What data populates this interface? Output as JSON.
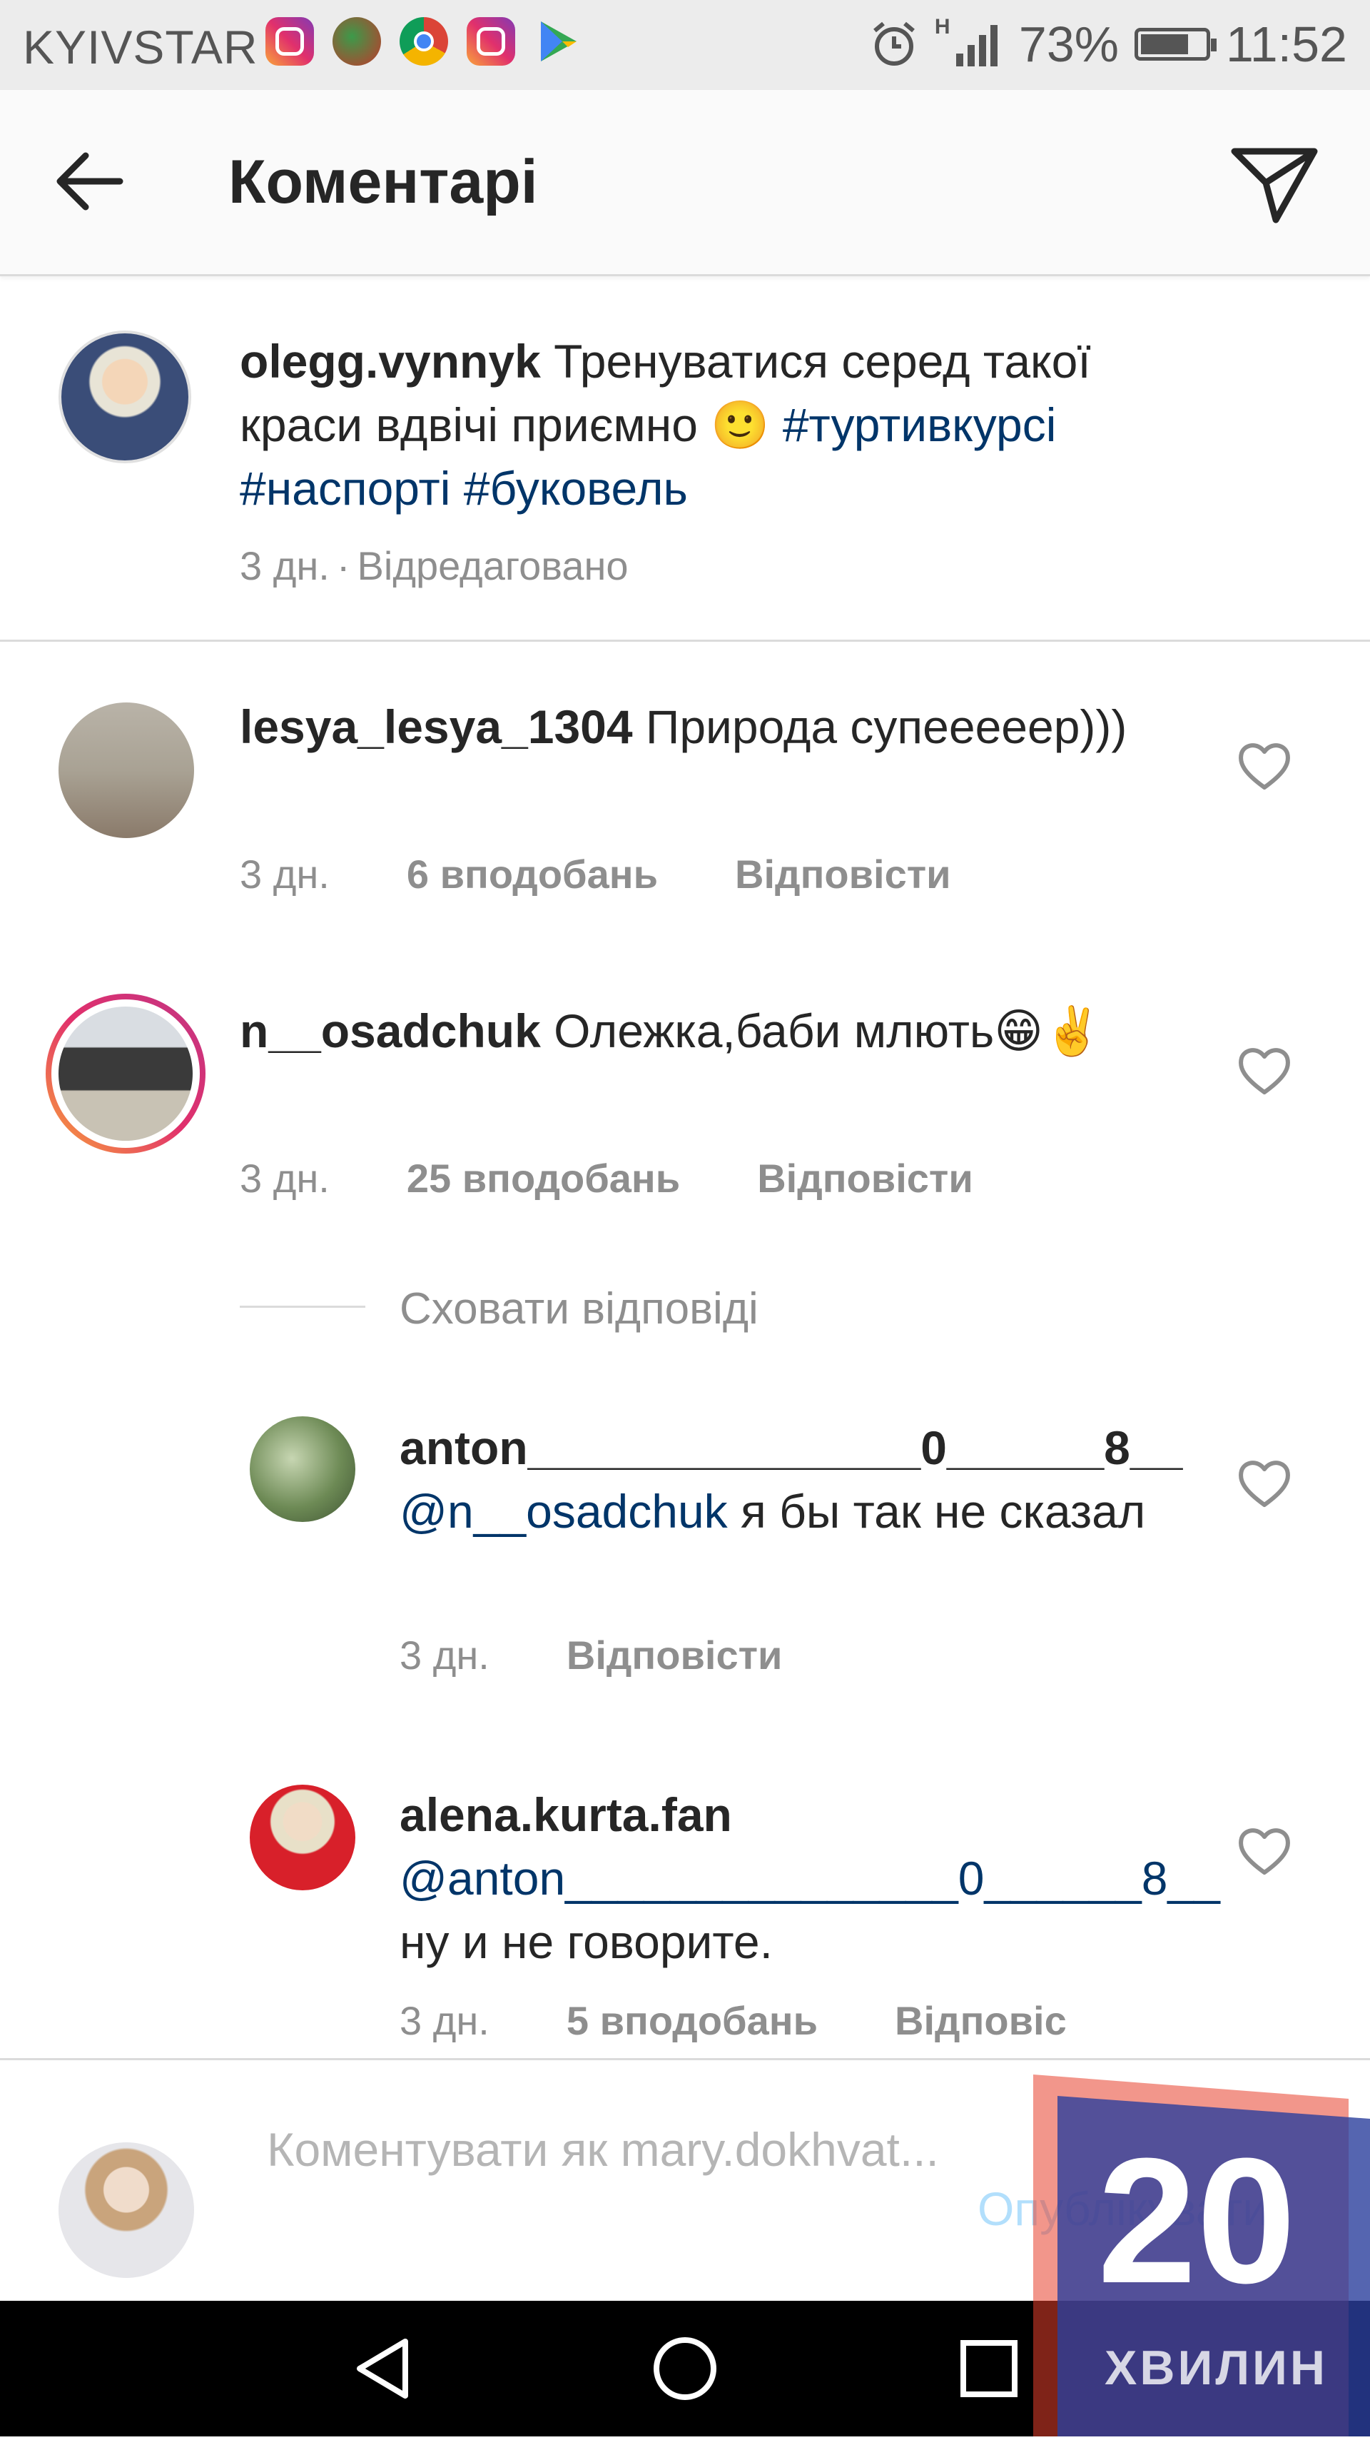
{
  "status_bar": {
    "carrier": "KYIVSTAR",
    "notification_icons": [
      "instagram-icon",
      "app-icon",
      "chrome-icon",
      "instagram-icon",
      "play-store-icon"
    ],
    "network": "H",
    "battery": "73%",
    "time": "11:52"
  },
  "header": {
    "title": "Коментарі"
  },
  "caption": {
    "username": "olegg.vynnyk",
    "text": "Тренуватися серед такої краси вдвічі приємно 🙂",
    "hashtags": [
      "#туртивкурсі",
      "#наспорті",
      "#буковель"
    ],
    "time": "3 дн.",
    "separator": "·",
    "edited": "Відредаговано"
  },
  "comments": [
    {
      "username": "lesya_lesya_1304",
      "text": "Природа супееееер)))",
      "time": "3 дн.",
      "likes": "6 вподобань",
      "reply": "Відповісти"
    },
    {
      "username": "n__osadchuk",
      "text": "Олежка,баби млють😁✌️",
      "time": "3 дн.",
      "likes": "25 вподобань",
      "reply": "Відповісти"
    }
  ],
  "hide_replies": "Сховати відповіді",
  "replies": [
    {
      "username": "anton_______________0______8__",
      "mention": "@n__osadchuk",
      "text": "я бы так не сказал",
      "time": "3 дн.",
      "reply": "Відповісти"
    },
    {
      "username": "alena.kurta.fan",
      "mention": "@anton_______________0______8__",
      "text": "ну и не говорите.",
      "time": "3 дн.",
      "likes": "5 вподобань",
      "reply": "Відповіс"
    }
  ],
  "composer": {
    "placeholder": "Коментувати як mary.dokhvat...",
    "publish": "Опублікувати"
  },
  "watermark": {
    "number": "20",
    "word": "ХВИЛИН"
  },
  "colors": {
    "link": "#003569",
    "meta": "#8e8e8e",
    "publish_disabled": "#b2dffc",
    "watermark_blue": "#2b3f9c",
    "watermark_red": "#e8402c"
  }
}
